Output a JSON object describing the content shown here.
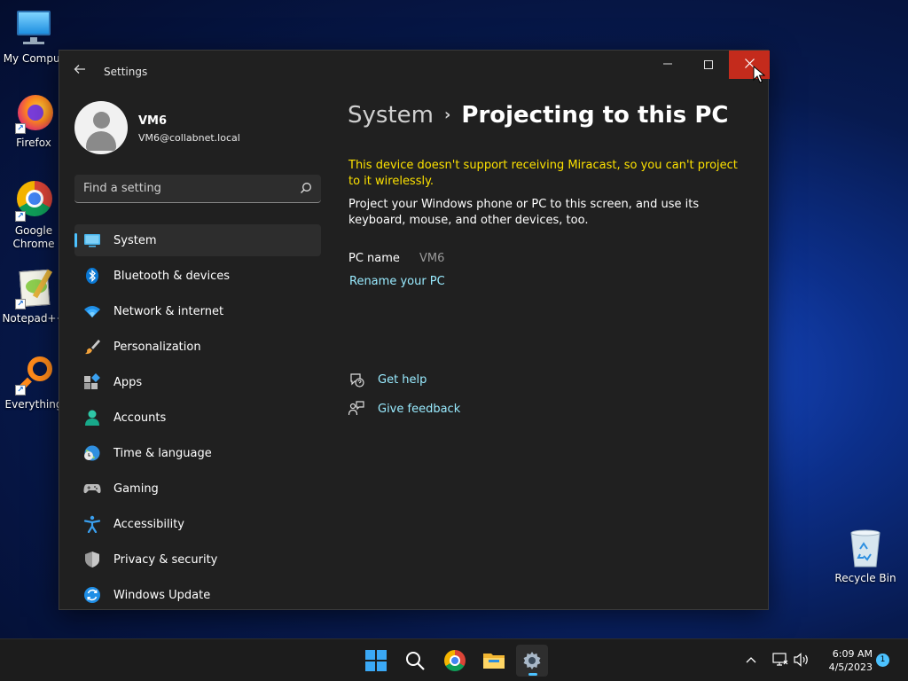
{
  "desktop": {
    "icons": [
      {
        "label": "My Comput"
      },
      {
        "label": "Firefox"
      },
      {
        "label": "Google Chrome"
      },
      {
        "label": "Notepad++"
      },
      {
        "label": "Everything"
      }
    ],
    "recycle_bin": "Recycle Bin"
  },
  "window": {
    "title": "Settings",
    "controls": {
      "minimize": "—",
      "close": "✕"
    }
  },
  "profile": {
    "name": "VM6",
    "email": "VM6@collabnet.local"
  },
  "search": {
    "placeholder": "Find a setting"
  },
  "nav": {
    "items": [
      {
        "label": "System",
        "icon": "monitor-icon",
        "active": true
      },
      {
        "label": "Bluetooth & devices",
        "icon": "bluetooth-icon"
      },
      {
        "label": "Network & internet",
        "icon": "wifi-icon"
      },
      {
        "label": "Personalization",
        "icon": "brush-icon"
      },
      {
        "label": "Apps",
        "icon": "apps-icon"
      },
      {
        "label": "Accounts",
        "icon": "accounts-icon"
      },
      {
        "label": "Time & language",
        "icon": "clock-globe-icon"
      },
      {
        "label": "Gaming",
        "icon": "controller-icon"
      },
      {
        "label": "Accessibility",
        "icon": "accessibility-icon"
      },
      {
        "label": "Privacy & security",
        "icon": "shield-icon"
      },
      {
        "label": "Windows Update",
        "icon": "update-icon"
      }
    ]
  },
  "main": {
    "breadcrumb": {
      "parent": "System",
      "separator": "›",
      "current": "Projecting to this PC"
    },
    "warning": "This device doesn't support receiving Miracast, so you can't project to it wirelessly.",
    "description": "Project your Windows phone or PC to this screen, and use its keyboard, mouse, and other devices, too.",
    "pc_name_label": "PC name",
    "pc_name_value": "VM6",
    "rename_link": "Rename your PC",
    "get_help": "Get help",
    "give_feedback": "Give feedback"
  },
  "taskbar": {
    "time": "6:09 AM",
    "date": "4/5/2023",
    "notification_count": "1",
    "tray_chevron": "^"
  },
  "colors": {
    "accent": "#4cc2ff",
    "warning": "#fce100",
    "link": "#99ebff",
    "close_red": "#c42b1c"
  }
}
